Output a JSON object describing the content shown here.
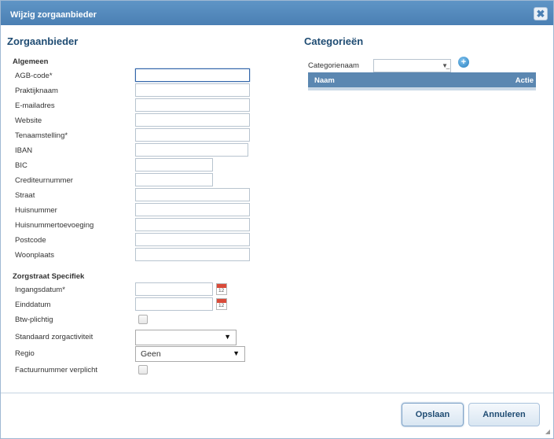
{
  "window": {
    "title": "Wijzig zorgaanbieder",
    "close_icon": "close-icon"
  },
  "left": {
    "heading": "Zorgaanbieder",
    "general_group": "Algemeen",
    "fields": [
      {
        "label": "AGB-code*",
        "value": ""
      },
      {
        "label": "Praktijknaam",
        "value": ""
      },
      {
        "label": "E-mailadres",
        "value": ""
      },
      {
        "label": "Website",
        "value": ""
      },
      {
        "label": "Tenaamstelling*",
        "value": ""
      },
      {
        "label": "IBAN",
        "value": ""
      },
      {
        "label": "BIC",
        "value": ""
      },
      {
        "label": "Crediteurnummer",
        "value": ""
      },
      {
        "label": "Straat",
        "value": ""
      },
      {
        "label": "Huisnummer",
        "value": ""
      },
      {
        "label": "Huisnummertoevoeging",
        "value": ""
      },
      {
        "label": "Postcode",
        "value": ""
      },
      {
        "label": "Woonplaats",
        "value": ""
      }
    ],
    "specific_group": "Zorgstraat Specifiek",
    "specific": {
      "start_label": "Ingangsdatum*",
      "end_label": "Einddatum",
      "vat_label": "Btw-plichtig",
      "activity_label": "Standaard zorgactiviteit",
      "activity_value": "",
      "region_label": "Regio",
      "region_value": "Geen",
      "invoice_label": "Factuurnummer verplicht",
      "calendar_number": "12"
    }
  },
  "right": {
    "heading": "Categorieën",
    "category_label": "Categorienaam",
    "category_value": "",
    "grid_columns": {
      "name": "Naam",
      "action": "Actie"
    }
  },
  "footer": {
    "save": "Opslaan",
    "cancel": "Annuleren"
  }
}
